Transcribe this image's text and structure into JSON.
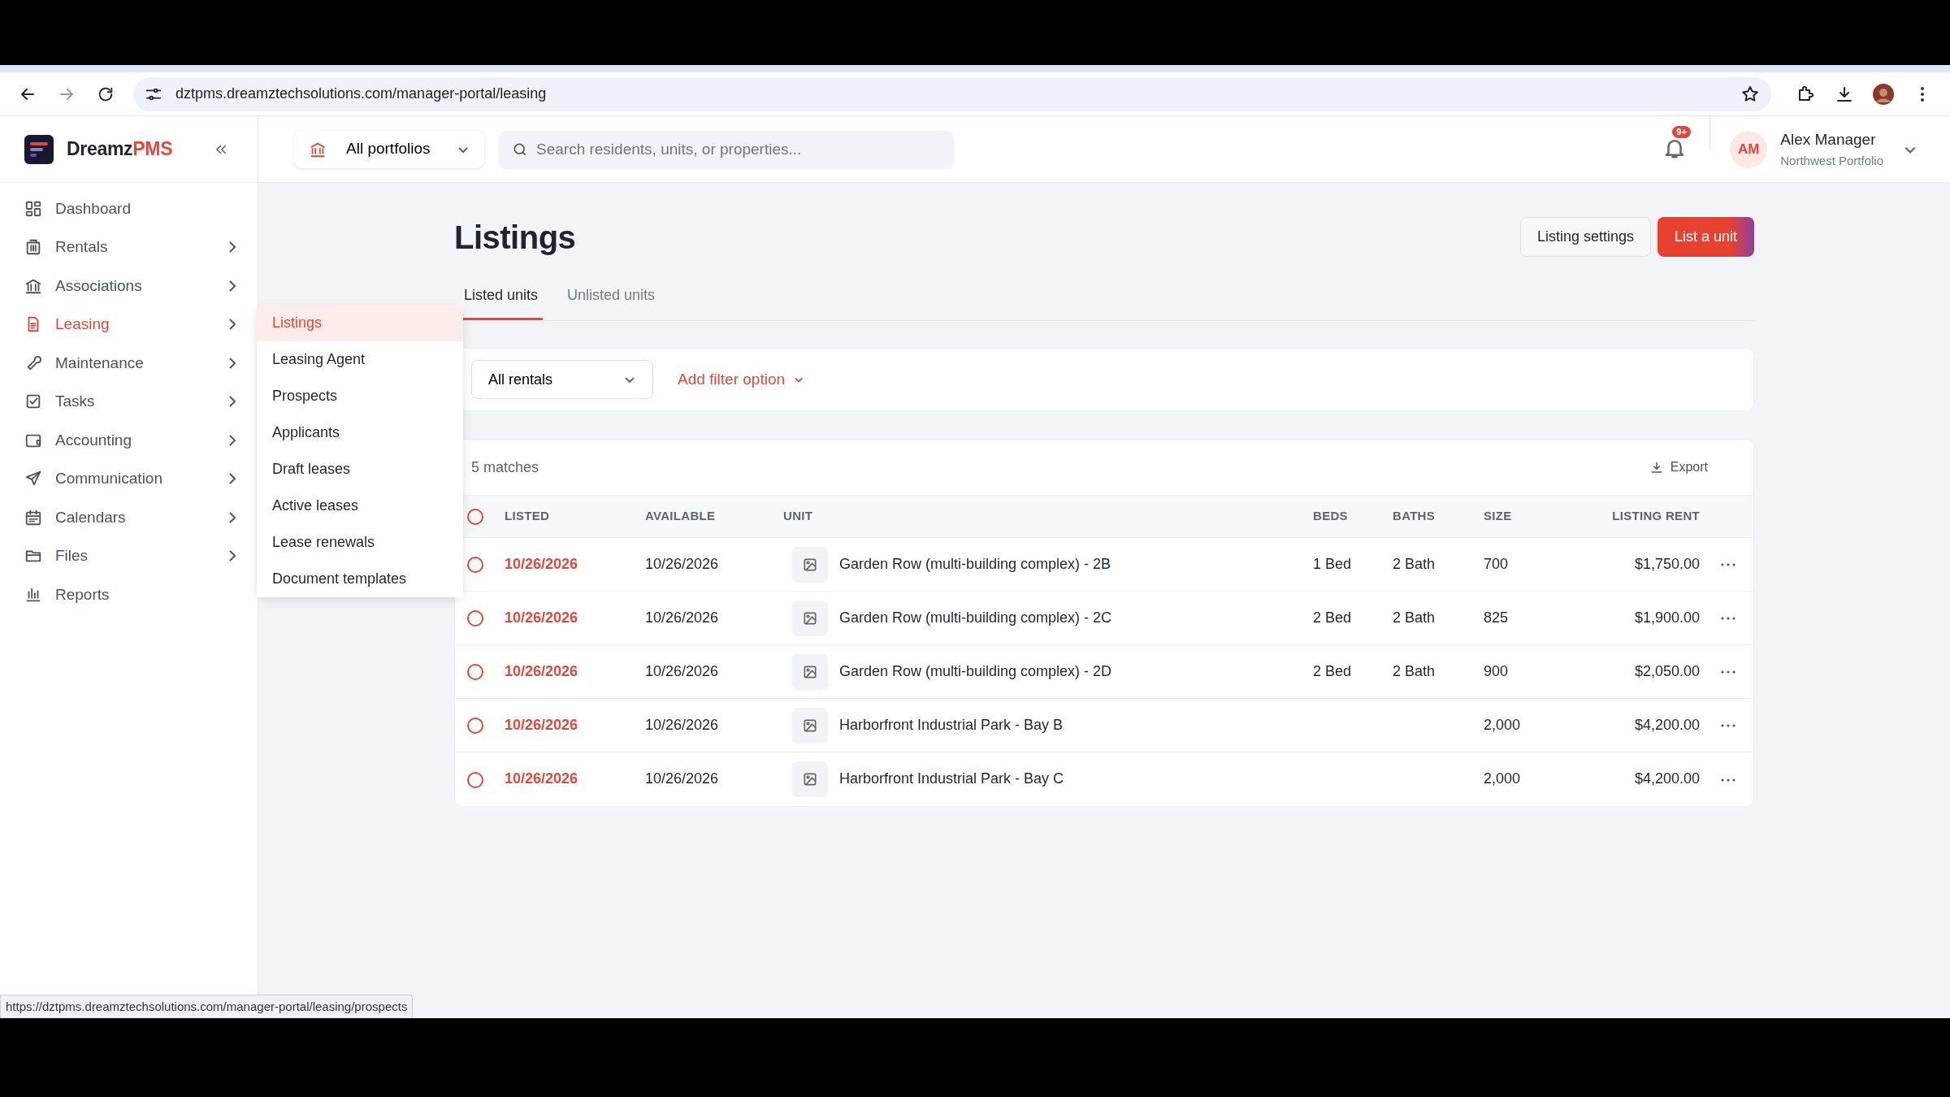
{
  "browser": {
    "url": "dztpms.dreamztechsolutions.com/manager-portal/leasing",
    "status_url": "https://dztpms.dreamztechsolutions.com/manager-portal/leasing/prospects"
  },
  "brand": {
    "text": "Dreamz",
    "accent": "PMS"
  },
  "sidebar": {
    "items": [
      {
        "label": "Dashboard",
        "selected": false,
        "expandable": false
      },
      {
        "label": "Rentals",
        "selected": false,
        "expandable": true
      },
      {
        "label": "Associations",
        "selected": false,
        "expandable": true
      },
      {
        "label": "Leasing",
        "selected": true,
        "expandable": true
      },
      {
        "label": "Maintenance",
        "selected": false,
        "expandable": true
      },
      {
        "label": "Tasks",
        "selected": false,
        "expandable": true
      },
      {
        "label": "Accounting",
        "selected": false,
        "expandable": true
      },
      {
        "label": "Communication",
        "selected": false,
        "expandable": true
      },
      {
        "label": "Calendars",
        "selected": false,
        "expandable": true
      },
      {
        "label": "Files",
        "selected": false,
        "expandable": true
      },
      {
        "label": "Reports",
        "selected": false,
        "expandable": false
      }
    ]
  },
  "submenu": {
    "items": [
      {
        "label": "Listings",
        "selected": true
      },
      {
        "label": "Leasing Agent",
        "selected": false
      },
      {
        "label": "Prospects",
        "selected": false
      },
      {
        "label": "Applicants",
        "selected": false
      },
      {
        "label": "Draft leases",
        "selected": false
      },
      {
        "label": "Active leases",
        "selected": false
      },
      {
        "label": "Lease renewals",
        "selected": false
      },
      {
        "label": "Document templates",
        "selected": false
      }
    ]
  },
  "header": {
    "portfolio": "All portfolios",
    "search_placeholder": "Search residents, units, or properties...",
    "notification_badge": "9+",
    "user": {
      "initials": "AM",
      "name": "Alex Manager",
      "subtitle": "Northwest Portfolio"
    }
  },
  "page": {
    "title": "Listings",
    "buttons": [
      {
        "label": "Listing settings",
        "kind": "secondary"
      },
      {
        "label": "List a unit",
        "kind": "primary"
      }
    ],
    "tabs": [
      {
        "label": "Listed units",
        "selected": true
      },
      {
        "label": "Unlisted units",
        "selected": false
      }
    ],
    "filter": {
      "select": "All rentals",
      "add_filter": "Add filter option"
    }
  },
  "table": {
    "count": "5 matches",
    "export": "Export",
    "select_all_checked": false,
    "columns": [
      "LISTED",
      "AVAILABLE",
      "UNIT",
      "BEDS",
      "BATHS",
      "SIZE",
      "LISTING RENT"
    ],
    "rows": [
      {
        "checked": false,
        "listed": "10/26/2026",
        "available": "10/26/2026",
        "unit": "Garden Row (multi-building complex) - 2B",
        "beds": "1 Bed",
        "baths": "2 Bath",
        "size": "700",
        "rent": "$1,750.00"
      },
      {
        "checked": false,
        "listed": "10/26/2026",
        "available": "10/26/2026",
        "unit": "Garden Row (multi-building complex) - 2C",
        "beds": "2 Bed",
        "baths": "2 Bath",
        "size": "825",
        "rent": "$1,900.00"
      },
      {
        "checked": false,
        "listed": "10/26/2026",
        "available": "10/26/2026",
        "unit": "Garden Row (multi-building complex) - 2D",
        "beds": "2 Bed",
        "baths": "2 Bath",
        "size": "900",
        "rent": "$2,050.00"
      },
      {
        "checked": false,
        "listed": "10/26/2026",
        "available": "10/26/2026",
        "unit": "Harborfront Industrial Park - Bay B",
        "size": "2,000",
        "rent": "$4,200.00"
      },
      {
        "checked": false,
        "listed": "10/26/2026",
        "available": "10/26/2026",
        "unit": "Harborfront Industrial Park - Bay C",
        "size": "2,000",
        "rent": "$4,200.00"
      }
    ]
  }
}
